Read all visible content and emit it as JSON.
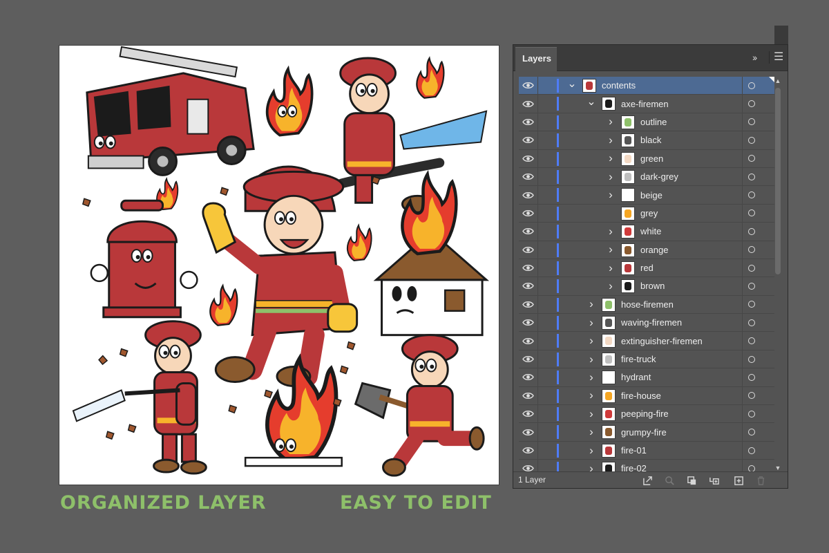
{
  "captions": {
    "left": "ORGANIZED LAYER",
    "right": "EASY TO EDIT"
  },
  "panel": {
    "tab_label": "Layers",
    "collapse_icon": "double-chevron-right-icon",
    "menu_icon": "hamburger-menu-icon",
    "footer": {
      "layer_count": "1 Layer",
      "buttons": [
        "export-icon",
        "locate-object-icon",
        "make-clipping-mask-icon",
        "create-sublayer-icon",
        "new-layer-icon",
        "delete-icon"
      ]
    },
    "layers": [
      {
        "label": "contents",
        "depth": 0,
        "expanded": true,
        "selected": true
      },
      {
        "label": "axe-firemen",
        "depth": 1,
        "expanded": true
      },
      {
        "label": "outline",
        "depth": 2,
        "expanded": false
      },
      {
        "label": "black",
        "depth": 2,
        "expanded": false
      },
      {
        "label": "green",
        "depth": 2,
        "expanded": false
      },
      {
        "label": "dark-grey",
        "depth": 2,
        "expanded": false
      },
      {
        "label": "beige",
        "depth": 2,
        "expanded": false
      },
      {
        "label": "grey",
        "depth": 2,
        "leaf": true
      },
      {
        "label": "white",
        "depth": 2,
        "expanded": false
      },
      {
        "label": "orange",
        "depth": 2,
        "expanded": false
      },
      {
        "label": "red",
        "depth": 2,
        "expanded": false
      },
      {
        "label": "brown",
        "depth": 2,
        "expanded": false
      },
      {
        "label": "hose-firemen",
        "depth": 1,
        "expanded": false
      },
      {
        "label": "waving-firemen",
        "depth": 1,
        "expanded": false
      },
      {
        "label": "extinguisher-firemen",
        "depth": 1,
        "expanded": false
      },
      {
        "label": "fire-truck",
        "depth": 1,
        "expanded": false
      },
      {
        "label": "hydrant",
        "depth": 1,
        "expanded": false
      },
      {
        "label": "fire-house",
        "depth": 1,
        "expanded": false
      },
      {
        "label": "peeping-fire",
        "depth": 1,
        "expanded": false
      },
      {
        "label": "grumpy-fire",
        "depth": 1,
        "expanded": false
      },
      {
        "label": "fire-01",
        "depth": 1,
        "expanded": false
      },
      {
        "label": "fire-02",
        "depth": 1,
        "expanded": false
      }
    ]
  },
  "colors": {
    "background": "#5e5e5e",
    "caption": "#8ec06a",
    "selection": "#4d6a93",
    "layer_color": "#4f7cf7",
    "fire_red": "#b9383a",
    "flame_orange": "#f5a623"
  },
  "artwork": {
    "elements": [
      "fire-truck",
      "axe-fireman-face-flame",
      "hose-firefighter",
      "waving-firefighter",
      "fire-hydrant",
      "burning-house",
      "extinguisher-firefighter",
      "peeping-fire",
      "axe-firefighter"
    ]
  }
}
